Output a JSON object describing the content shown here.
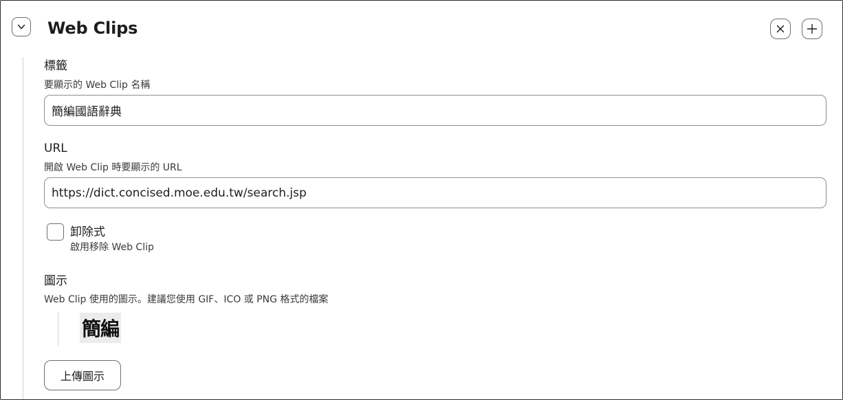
{
  "header": {
    "title": "Web Clips",
    "collapse_icon": "chevron-down-icon",
    "remove_icon": "close-icon",
    "add_icon": "plus-icon"
  },
  "label_field": {
    "label": "標籤",
    "help": "要顯示的 Web Clip 名稱",
    "value": "簡編國語辭典"
  },
  "url_field": {
    "label": "URL",
    "help": "開啟 Web Clip 時要顯示的 URL",
    "value": "https://dict.concised.moe.edu.tw/search.jsp"
  },
  "removable": {
    "label": "卸除式",
    "help": "啟用移除 Web Clip",
    "checked": false
  },
  "icon_field": {
    "label": "圖示",
    "help": "Web Clip 使用的圖示。建議您使用 GIF、ICO 或 PNG 格式的檔案",
    "preview_text": "簡編",
    "upload_label": "上傳圖示"
  }
}
